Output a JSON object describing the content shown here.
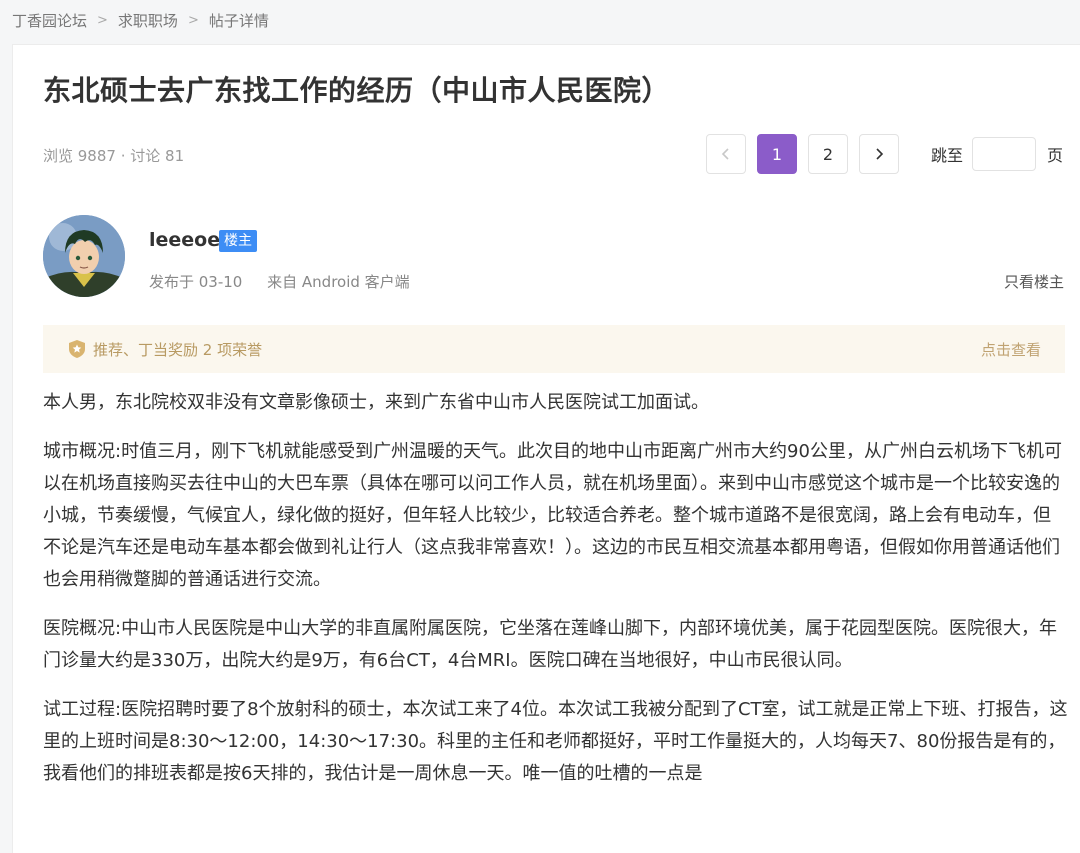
{
  "breadcrumb": {
    "items": [
      "丁香园论坛",
      "求职职场",
      "帖子详情"
    ],
    "separator": ">"
  },
  "post": {
    "title": "东北硕士去广东找工作的经历（中山市人民医院）",
    "views_label": "浏览 9887",
    "comments_label": "· 讨论 81"
  },
  "pagination": {
    "pages": [
      "1",
      "2"
    ],
    "current": "1",
    "jump_label": "跳至",
    "jump_suffix": "页",
    "jump_value": ""
  },
  "author": {
    "name": "leeeoe",
    "badge": "楼主",
    "posted": "发布于 03-10",
    "source": "来自 Android 客户端",
    "only_op": "只看楼主"
  },
  "honor": {
    "text": "推荐、丁当奖励 2 项荣誉",
    "link": "点击查看"
  },
  "content": {
    "paragraphs": [
      "本人男，东北院校双非没有文章影像硕士，来到广东省中山市人民医院试工加面试。",
      "城市概况:时值三月，刚下飞机就能感受到广州温暖的天气。此次目的地中山市距离广州市大约90公里，从广州白云机场下飞机可以在机场直接购买去往中山的大巴车票（具体在哪可以问工作人员，就在机场里面）。来到中山市感觉这个城市是一个比较安逸的小城，节奏缓慢，气候宜人，绿化做的挺好，但年轻人比较少，比较适合养老。整个城市道路不是很宽阔，路上会有电动车，但不论是汽车还是电动车基本都会做到礼让行人（这点我非常喜欢！）。这边的市民互相交流基本都用粤语，但假如你用普通话他们也会用稍微蹩脚的普通话进行交流。",
      "医院概况:中山市人民医院是中山大学的非直属附属医院，它坐落在莲峰山脚下，内部环境优美，属于花园型医院。医院很大，年门诊量大约是330万，出院大约是9万，有6台CT，4台MRI。医院口碑在当地很好，中山市民很认同。",
      "试工过程:医院招聘时要了8个放射科的硕士，本次试工来了4位。本次试工我被分配到了CT室，试工就是正常上下班、打报告，这里的上班时间是8:30～12:00，14:30～17:30。科里的主任和老师都挺好，平时工作量挺大的，人均每天7、80份报告是有的，我看他们的排班表都是按6天排的，我估计是一周休息一天。唯一值的吐槽的一点是"
    ]
  },
  "colors": {
    "accent": "#8b5cc9",
    "badge": "#3d8df5",
    "honor_bg": "#fbf7ee",
    "honor_text": "#b89a62"
  },
  "icons": [
    "chevron-left-icon",
    "chevron-right-icon",
    "medal-icon",
    "avatar-image"
  ]
}
